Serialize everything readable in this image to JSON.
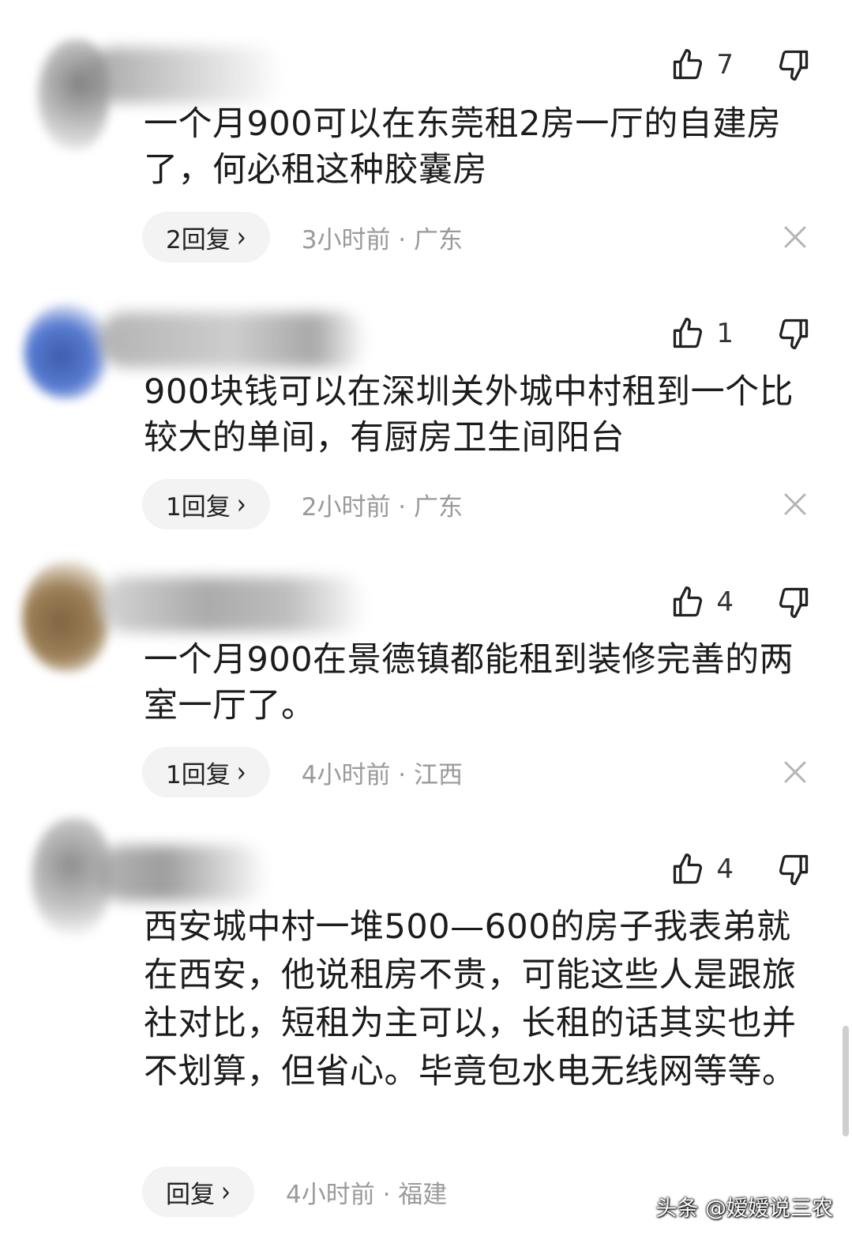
{
  "comments": [
    {
      "likes": "7",
      "text": "一个月900可以在东莞租2房一厅的自建房了，何必租这种胶囊房",
      "reply_label": "2回复",
      "time_location": "3小时前 · 广东"
    },
    {
      "likes": "1",
      "text": "900块钱可以在深圳关外城中村租到一个比较大的单间，有厨房卫生间阳台",
      "reply_label": "1回复",
      "time_location": "2小时前 · 广东"
    },
    {
      "likes": "4",
      "text": "一个月900在景德镇都能租到装修完善的两室一厅了。",
      "reply_label": "1回复",
      "time_location": "4小时前 · 江西"
    },
    {
      "likes": "4",
      "text": "西安城中村一堆500—600的房子我表弟就在西安，他说租房不贵，可能这些人是跟旅社对比，短租为主可以，长租的话其实也并不划算，但省心。毕竟包水电无线网等等。",
      "reply_label": "回复",
      "time_location": "4小时前 · 福建"
    }
  ],
  "chevron": "›",
  "watermark": "头条 @嫒嫒说三农",
  "icons": {
    "like": "thumbs-up-icon",
    "dislike": "thumbs-down-icon",
    "close": "close-icon"
  }
}
